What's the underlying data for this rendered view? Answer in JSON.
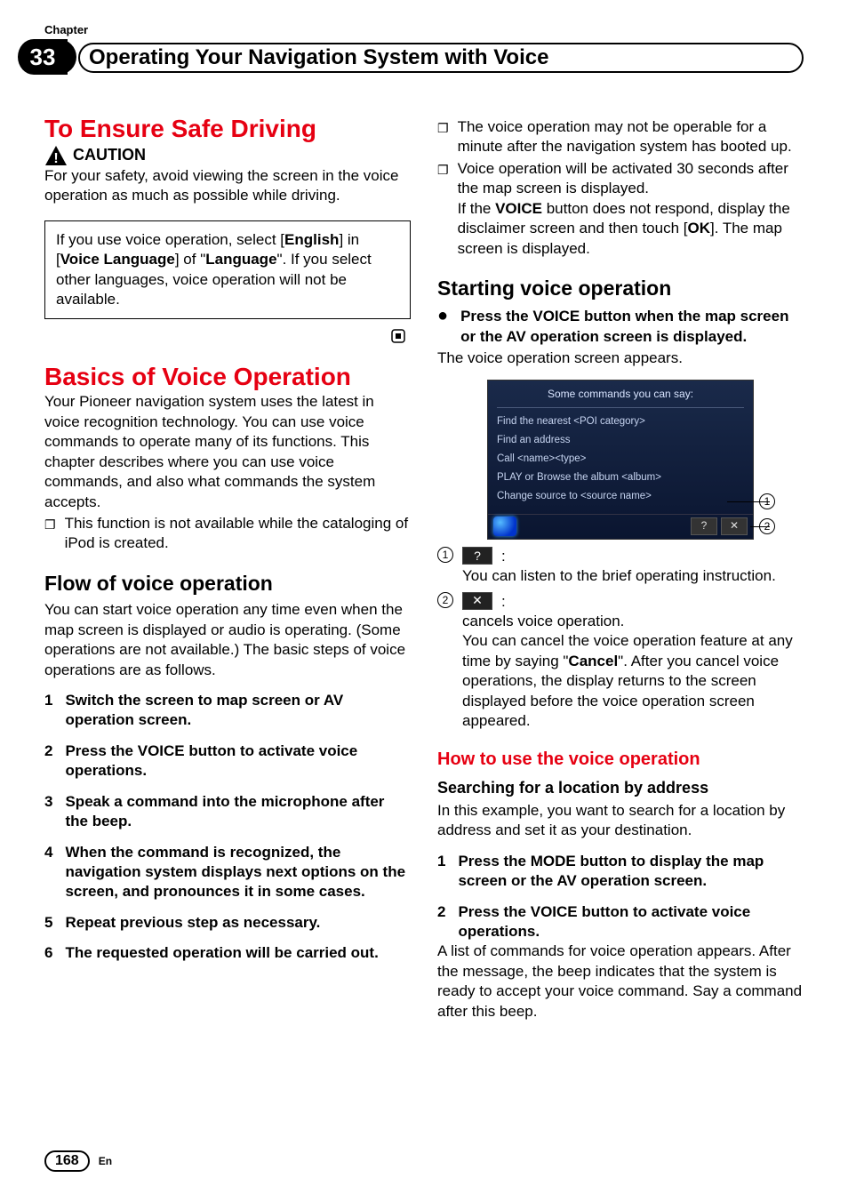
{
  "chapter": {
    "label": "Chapter",
    "number": "33",
    "title": "Operating Your Navigation System with Voice"
  },
  "left": {
    "h1_safe": "To Ensure Safe Driving",
    "caution_label": "CAUTION",
    "caution_body": "For your safety, avoid viewing the screen in the voice operation as much as possible while driving.",
    "box_pre": "If you use voice operation, select [",
    "box_english": "English",
    "box_mid1": "] in [",
    "box_voicelang": "Voice Language",
    "box_mid2": "] of \"",
    "box_language": "Language",
    "box_post": "\". If you select other languages, voice operation will not be available.",
    "h1_basics": "Basics of Voice Operation",
    "basics_body": "Your Pioneer navigation system uses the latest in voice recognition technology. You can use voice commands to operate many of its functions. This chapter describes where you can use voice commands, and also what commands the system accepts.",
    "basics_bullet": "This function is not available while the cataloging of iPod is created.",
    "h2_flow": "Flow of voice operation",
    "flow_body": "You can start voice operation any time even when the map screen is displayed or audio is operating. (Some operations are not available.) The basic steps of voice operations are as follows.",
    "step1": "Switch the screen to map screen or AV operation screen.",
    "step2": "Press the VOICE button to activate voice operations.",
    "step3": "Speak a command into the microphone after the beep.",
    "step4": "When the command is recognized, the navigation system displays next options on the screen, and pronounces it in some cases.",
    "step5": "Repeat previous step as necessary.",
    "step6": "The requested operation will be carried out."
  },
  "right": {
    "bullet1": "The voice operation may not be operable for a minute after the navigation system has booted up.",
    "bullet2_a": "Voice operation will be activated 30 seconds after the map screen is displayed.",
    "bullet2_b1": "If the ",
    "bullet2_voice": "VOICE",
    "bullet2_b2": " button does not respond, display the disclaimer screen and then touch [",
    "bullet2_ok": "OK",
    "bullet2_b3": "]. The map screen is displayed.",
    "h2_start": "Starting voice operation",
    "lead": "Press the VOICE button when the map screen or the AV operation screen is displayed.",
    "lead_after": "The voice operation screen appears.",
    "shot": {
      "title": "Some commands you can say:",
      "l1": "Find the nearest <POI category>",
      "l2": "Find an address",
      "l3": "Call <name><type>",
      "l4": "PLAY or Browse the album <album>",
      "l5": "Change source to <source name>"
    },
    "legend1": "You can listen to the brief operating instruction.",
    "legend2_a": "cancels voice operation.",
    "legend2_b1": "You can cancel the voice operation feature at any time by saying \"",
    "legend2_cancel": "Cancel",
    "legend2_b2": "\". After you cancel voice operations, the display returns to the screen displayed before the voice operation screen appeared.",
    "h3_how": "How to use the voice operation",
    "h4_search": "Searching for a location by address",
    "search_body": "In this example, you want to search for a location by address and set it as your destination.",
    "rstep1": "Press the MODE button to display the map screen or the AV operation screen.",
    "rstep2": "Press the VOICE button to activate voice operations.",
    "rstep2_after": "A list of commands for voice operation appears. After the message, the beep indicates that the system is ready to accept your voice command. Say a command after this beep."
  },
  "footer": {
    "page": "168",
    "lang": "En"
  }
}
